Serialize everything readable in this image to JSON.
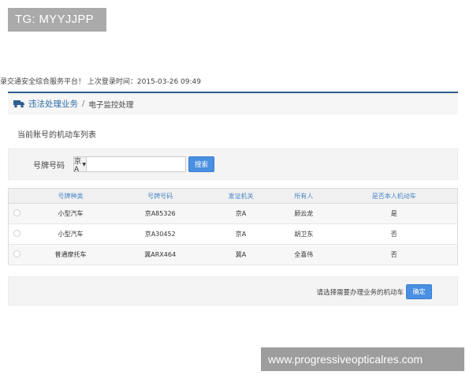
{
  "badge": {
    "text": "TG: MYYJJPP"
  },
  "header": {
    "welcome": "录交通安全综合服务平台！ 上次登录时间：2015-03-26 09:49"
  },
  "breadcrumb": {
    "icon": "truck-icon",
    "link": "违法处理业务",
    "separator": "/",
    "current": "电子监控处理"
  },
  "list_title": "当前账号的机动车列表",
  "search": {
    "label": "号牌号码",
    "prefix": "京A",
    "input_value": "",
    "button": "搜索"
  },
  "table": {
    "columns": [
      "号牌种类",
      "号牌号码",
      "发证机关",
      "所有人",
      "是否本人机动车"
    ],
    "rows": [
      {
        "type": "小型汽车",
        "plate": "京A85326",
        "issuer": "京A",
        "owner": "顾云龙",
        "own": "是"
      },
      {
        "type": "小型汽车",
        "plate": "京A30452",
        "issuer": "京A",
        "owner": "胡卫东",
        "own": "否"
      },
      {
        "type": "普通摩托车",
        "plate": "冀ARX464",
        "issuer": "冀A",
        "owner": "全喜伟",
        "own": "否"
      }
    ]
  },
  "confirm": {
    "text": "请选择需要办理业务的机动车",
    "button": "确定"
  },
  "watermark": {
    "text": "www.progressiveopticalres.com"
  },
  "colors": {
    "accent": "#4a90e2",
    "link": "#2b6aa8",
    "header_text": "#4a86c8",
    "negative": "#c0392b"
  }
}
